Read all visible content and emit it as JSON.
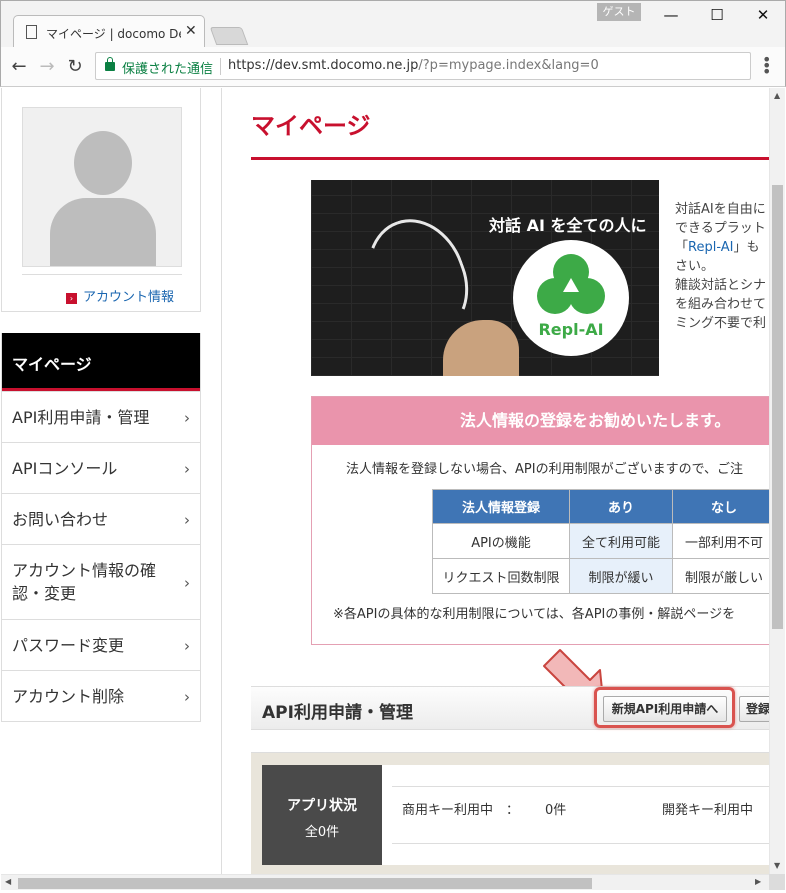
{
  "browser": {
    "tab_title": "マイページ | docomo Devel",
    "close": "✕",
    "guest_badge": "ゲスト",
    "minimize": "—",
    "maximize": "☐",
    "window_close": "✕",
    "back": "←",
    "forward": "→",
    "reload": "↻",
    "secure_label": "保護された通信",
    "url_host": "https://dev.smt.docomo.ne.jp",
    "url_path": "/?p=mypage.index&lang=0",
    "menu": "⋮"
  },
  "sidebar": {
    "account_link": "アカウント情報",
    "active": "マイページ",
    "items": [
      {
        "label": "API利用申請・管理"
      },
      {
        "label": "APIコンソール"
      },
      {
        "label": "お問い合わせ"
      },
      {
        "label": "アカウント情報の確認・変更"
      },
      {
        "label": "パスワード変更"
      },
      {
        "label": "アカウント削除"
      }
    ],
    "chevron": "›"
  },
  "main": {
    "title": "マイページ",
    "hero": {
      "catchphrase": "対話 AI を全ての人に",
      "logo_text": "Repl-AI"
    },
    "intro_lines": [
      "対話AIを自由に",
      "できるプラット",
      "「Repl-AI」も",
      "さい。",
      "雑談対話とシナ",
      "を組み合わせて",
      "ミング不要で利"
    ],
    "intro_link": "Repl-AI",
    "corp": {
      "heading": "法人情報の登録をお勧めいたします。",
      "text": "法人情報を登録しない場合、APIの利用制限がございますので、ご注",
      "table": {
        "headers": [
          "法人情報登録",
          "あり",
          "なし"
        ],
        "rows": [
          [
            "APIの機能",
            "全て利用可能",
            "一部利用不可"
          ],
          [
            "リクエスト回数制限",
            "制限が緩い",
            "制限が厳しい"
          ]
        ]
      },
      "note": "※各APIの具体的な利用制限については、各APIの事例・解説ページを"
    },
    "api": {
      "title": "API利用申請・管理",
      "new_button": "新規API利用申請へ",
      "register_button": "登録"
    },
    "status": {
      "label": "アプリ状況",
      "count": "全0件",
      "commercial_label": "商用キー利用中　：",
      "commercial_count": "0件",
      "dev_label": "開発キー利用中"
    }
  },
  "colors": {
    "accent": "#c8102e",
    "table_header": "#3f75b5",
    "corp_header": "#ea94ac",
    "logo_green": "#3daa47"
  }
}
